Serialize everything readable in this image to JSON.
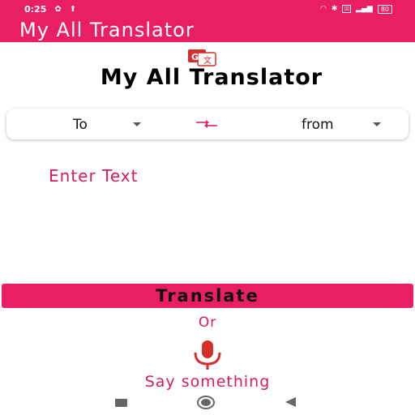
{
  "status_bar": {
    "time": "0:25",
    "battery": "80",
    "icons": [
      "settings-icon",
      "upload-icon",
      "wifi-icon",
      "bluetooth-icon",
      "vibrate-icon",
      "signal-icon",
      "battery-icon"
    ]
  },
  "app_bar": {
    "title": "My All Translator"
  },
  "header": {
    "logo_icon": "google-translate-icon",
    "title": "My All Translator"
  },
  "language_selector": {
    "to_label": "To",
    "from_label": "from",
    "swap_icon": "swap-arrows-icon"
  },
  "input": {
    "placeholder": "Enter Text"
  },
  "translate_button": {
    "label": "Translate"
  },
  "voice": {
    "or_label": "Or",
    "mic_icon": "microphone-icon",
    "prompt": "Say something"
  },
  "nav_bar": {
    "icons": [
      "recents-icon",
      "home-icon",
      "back-icon"
    ]
  },
  "colors": {
    "accent": "#e91e63",
    "accent_text": "#d81b60"
  }
}
